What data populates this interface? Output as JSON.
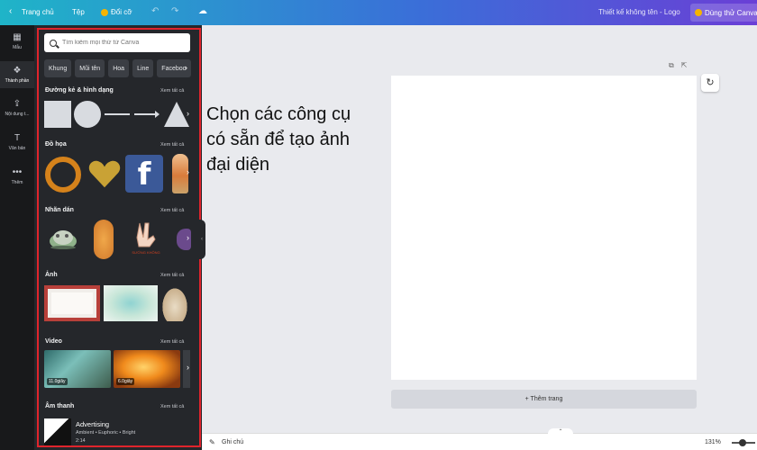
{
  "topbar": {
    "back_icon": "chevron-left-icon",
    "home": "Trang chủ",
    "file": "Tệp",
    "resize": "Đổi cỡ",
    "title": "Thiết kế không tên - Logo",
    "trial": "Dùng thử Canva"
  },
  "rail": {
    "items": [
      {
        "label": "Mẫu",
        "icon": "template-icon"
      },
      {
        "label": "Thành phần",
        "icon": "elements-icon"
      },
      {
        "label": "Nội dung t...",
        "icon": "upload-icon"
      },
      {
        "label": "Văn bản",
        "icon": "text-icon"
      },
      {
        "label": "Thêm",
        "icon": "more-icon"
      }
    ]
  },
  "panel": {
    "search_placeholder": "Tìm kiếm mọi thứ từ Canva",
    "chips": [
      "Khung",
      "Mũi tên",
      "Hoa",
      "Line",
      "Faceboo"
    ],
    "see_all": "Xem tất cả",
    "sections": {
      "shapes": "Đường kẻ & hình dạng",
      "graphics": "Đồ họa",
      "stickers": "Nhãn dán",
      "photos": "Ảnh",
      "videos": "Video",
      "audio": "Âm thanh"
    },
    "graphics": {
      "fb_letter": "f"
    },
    "stickers": {
      "hand_caption": "SƯỚNG KHÔNG"
    },
    "videos": [
      {
        "duration": "11.0giây"
      },
      {
        "duration": "6.0giây"
      }
    ],
    "audio": {
      "title": "Advertising",
      "meta": "Ambient • Euphoric • Bright",
      "duration": "2:14"
    }
  },
  "annotation": {
    "line1": "Chọn các công cụ",
    "line2": "có sẵn để tạo ảnh",
    "line3": "đại diện"
  },
  "editor": {
    "add_page": "+ Thêm trang"
  },
  "bottombar": {
    "notes": "Ghi chú",
    "zoom": "131%"
  },
  "colors": {
    "panel_border": "#e0242c",
    "panel_bg": "#25272b",
    "topbar_start": "#1fb4c8",
    "topbar_end": "#6a3fd6"
  }
}
